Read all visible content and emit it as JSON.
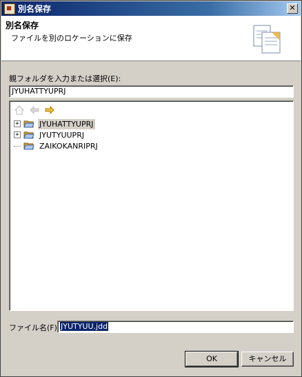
{
  "window": {
    "title": "別名保存",
    "close_glyph": "✕"
  },
  "header": {
    "title": "別名保存",
    "description": "ファイルを別のロケーションに保存",
    "icon": "documents-icon"
  },
  "folder": {
    "label": "親フォルダを入力または選択(E):",
    "value": "JYUHATTYUPRJ"
  },
  "toolbar": {
    "home_icon": "home-icon",
    "back_icon": "back-arrow-icon",
    "forward_icon": "forward-arrow-icon"
  },
  "tree": {
    "items": [
      {
        "label": "JYUHATTYUPRJ",
        "expander": "+",
        "selected": true
      },
      {
        "label": "JYUTYUUPRJ",
        "expander": "+",
        "selected": false
      },
      {
        "label": "ZAIKOKANRIPRJ",
        "expander": "",
        "selected": false
      }
    ]
  },
  "filename": {
    "label": "ファイル名(F):",
    "value": "JYUTYUU.jdd"
  },
  "buttons": {
    "ok": "OK",
    "cancel": "キャンセル"
  },
  "colors": {
    "title_bar": "#0a246a",
    "selection": "#0a246a",
    "face": "#d4d0c8"
  }
}
